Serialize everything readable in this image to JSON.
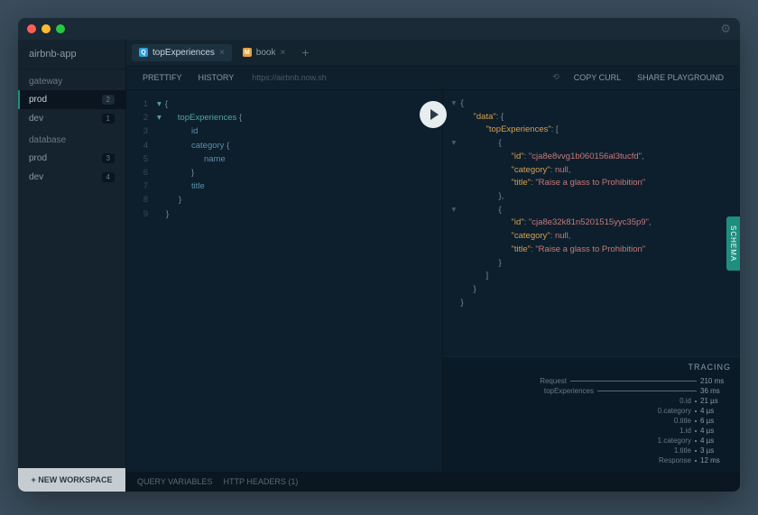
{
  "app_name": "airbnb-app",
  "sidebar": {
    "sections": [
      {
        "title": "gateway",
        "items": [
          {
            "label": "prod",
            "badge": "2",
            "active": true
          },
          {
            "label": "dev",
            "badge": "1",
            "active": false
          }
        ]
      },
      {
        "title": "database",
        "items": [
          {
            "label": "prod",
            "badge": "3",
            "active": false
          },
          {
            "label": "dev",
            "badge": "4",
            "active": false
          }
        ]
      }
    ],
    "new_workspace": "+ NEW WORKSPACE"
  },
  "tabs": [
    {
      "icon": "Q",
      "label": "topExperiences",
      "active": true
    },
    {
      "icon": "M",
      "label": "book",
      "active": false
    }
  ],
  "toolbar": {
    "prettify": "PRETTIFY",
    "history": "HISTORY",
    "endpoint": "https://airbnb.now.sh",
    "copy_curl": "COPY CURL",
    "share": "SHARE PLAYGROUND"
  },
  "query_lines": [
    {
      "n": "1",
      "indent": 0,
      "tokens": [
        {
          "t": "{",
          "c": "brace"
        }
      ],
      "caret": "▾"
    },
    {
      "n": "2",
      "indent": 1,
      "tokens": [
        {
          "t": "topExperiences",
          "c": "kw"
        },
        {
          "t": " {",
          "c": "brace"
        }
      ],
      "caret": "▾"
    },
    {
      "n": "3",
      "indent": 2,
      "tokens": [
        {
          "t": "id",
          "c": "fld"
        }
      ]
    },
    {
      "n": "4",
      "indent": 2,
      "tokens": [
        {
          "t": "category",
          "c": "fld"
        },
        {
          "t": " {",
          "c": "brace"
        }
      ]
    },
    {
      "n": "5",
      "indent": 3,
      "tokens": [
        {
          "t": "name",
          "c": "fld"
        }
      ]
    },
    {
      "n": "6",
      "indent": 2,
      "tokens": [
        {
          "t": "}",
          "c": "brace"
        }
      ]
    },
    {
      "n": "7",
      "indent": 2,
      "tokens": [
        {
          "t": "title",
          "c": "fld"
        }
      ]
    },
    {
      "n": "8",
      "indent": 1,
      "tokens": [
        {
          "t": "}",
          "c": "brace"
        }
      ]
    },
    {
      "n": "9",
      "indent": 0,
      "tokens": [
        {
          "t": "}",
          "c": "brace"
        }
      ]
    }
  ],
  "response_lines": [
    {
      "indent": 0,
      "caret": "▾",
      "tokens": [
        {
          "t": "{",
          "c": "brace"
        }
      ]
    },
    {
      "indent": 1,
      "caret": "",
      "tokens": [
        {
          "t": "\"data\"",
          "c": "key"
        },
        {
          "t": ": {",
          "c": "brace"
        }
      ]
    },
    {
      "indent": 2,
      "caret": "",
      "tokens": [
        {
          "t": "\"topExperiences\"",
          "c": "key"
        },
        {
          "t": ": [",
          "c": "brace"
        }
      ]
    },
    {
      "indent": 3,
      "caret": "▾",
      "tokens": [
        {
          "t": "{",
          "c": "brace"
        }
      ]
    },
    {
      "indent": 4,
      "caret": "",
      "tokens": [
        {
          "t": "\"id\"",
          "c": "key"
        },
        {
          "t": ": ",
          "c": "punc"
        },
        {
          "t": "\"cja8e8vvg1b060156al3tucfd\"",
          "c": "str"
        },
        {
          "t": ",",
          "c": "punc"
        }
      ]
    },
    {
      "indent": 4,
      "caret": "",
      "tokens": [
        {
          "t": "\"category\"",
          "c": "key"
        },
        {
          "t": ": ",
          "c": "punc"
        },
        {
          "t": "null",
          "c": "nul"
        },
        {
          "t": ",",
          "c": "punc"
        }
      ]
    },
    {
      "indent": 4,
      "caret": "",
      "tokens": [
        {
          "t": "\"title\"",
          "c": "key"
        },
        {
          "t": ": ",
          "c": "punc"
        },
        {
          "t": "\"Raise a glass to Prohibition\"",
          "c": "str"
        }
      ]
    },
    {
      "indent": 3,
      "caret": "",
      "tokens": [
        {
          "t": "},",
          "c": "brace"
        }
      ]
    },
    {
      "indent": 3,
      "caret": "▾",
      "tokens": [
        {
          "t": "{",
          "c": "brace"
        }
      ]
    },
    {
      "indent": 4,
      "caret": "",
      "tokens": [
        {
          "t": "\"id\"",
          "c": "key"
        },
        {
          "t": ": ",
          "c": "punc"
        },
        {
          "t": "\"cja8e32k81n5201515yyc35p9\"",
          "c": "str"
        },
        {
          "t": ",",
          "c": "punc"
        }
      ]
    },
    {
      "indent": 4,
      "caret": "",
      "tokens": [
        {
          "t": "\"category\"",
          "c": "key"
        },
        {
          "t": ": ",
          "c": "punc"
        },
        {
          "t": "null",
          "c": "nul"
        },
        {
          "t": ",",
          "c": "punc"
        }
      ]
    },
    {
      "indent": 4,
      "caret": "",
      "tokens": [
        {
          "t": "\"title\"",
          "c": "key"
        },
        {
          "t": ": ",
          "c": "punc"
        },
        {
          "t": "\"Raise a glass to Prohibition\"",
          "c": "str"
        }
      ]
    },
    {
      "indent": 3,
      "caret": "",
      "tokens": [
        {
          "t": "}",
          "c": "brace"
        }
      ]
    },
    {
      "indent": 2,
      "caret": "",
      "tokens": [
        {
          "t": "]",
          "c": "brace"
        }
      ]
    },
    {
      "indent": 1,
      "caret": "",
      "tokens": [
        {
          "t": "}",
          "c": "brace"
        }
      ]
    },
    {
      "indent": 0,
      "caret": "",
      "tokens": [
        {
          "t": "}",
          "c": "brace"
        }
      ]
    }
  ],
  "tracing": {
    "title": "TRACING",
    "rows": [
      {
        "label": "Request",
        "bar": 140,
        "val": "210 ms"
      },
      {
        "label": "topExperiences",
        "bar": 110,
        "val": "36 ms"
      },
      {
        "label": "0.id",
        "bar": 0,
        "dot": true,
        "val": "21 µs"
      },
      {
        "label": "0.category",
        "bar": 0,
        "dot": true,
        "val": "4 µs"
      },
      {
        "label": "0.title",
        "bar": 0,
        "dot": true,
        "val": "6 µs"
      },
      {
        "label": "1.id",
        "bar": 0,
        "dot": true,
        "val": "4 µs"
      },
      {
        "label": "1.category",
        "bar": 0,
        "dot": true,
        "val": "4 µs"
      },
      {
        "label": "1.title",
        "bar": 0,
        "dot": true,
        "val": "3 µs"
      },
      {
        "label": "Response",
        "bar": 0,
        "dot": true,
        "val": "12 ms"
      }
    ]
  },
  "schema_label": "SCHEMA",
  "footer": {
    "query_vars": "QUERY VARIABLES",
    "http_headers": "HTTP HEADERS (1)"
  }
}
